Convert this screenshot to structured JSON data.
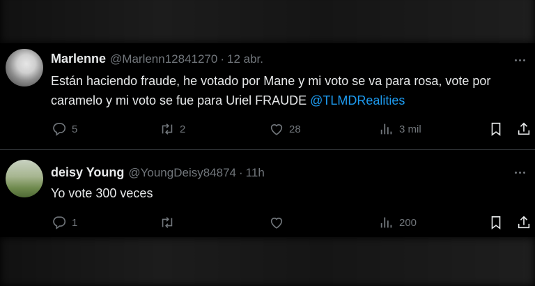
{
  "tweets": [
    {
      "name": "Marlenne",
      "handle": "@Marlenn12841270",
      "separator": "·",
      "time": "12 abr.",
      "text": "Están haciendo fraude, he votado por Mane y mi voto se va para rosa, vote por caramelo y mi voto se fue para Uriel FRAUDE ",
      "mention": "@TLMDRealities",
      "replies": "5",
      "retweets": "2",
      "likes": "28",
      "views": "3 mil"
    },
    {
      "name": "deisy Young",
      "handle": "@YoungDeisy84874",
      "separator": "·",
      "time": "11h",
      "text": "Yo vote 300 veces",
      "replies": "1",
      "retweets": "",
      "likes": "",
      "views": "200"
    }
  ],
  "icons": {
    "reply": "reply-icon",
    "retweet": "retweet-icon",
    "like": "heart-icon",
    "views": "views-icon",
    "bookmark": "bookmark-icon",
    "share": "share-icon",
    "more": "more-icon"
  },
  "colors": {
    "background": "#000000",
    "text": "#e7e9ea",
    "muted": "#71767b",
    "link": "#1d9bf0",
    "divider": "#2f3336"
  }
}
